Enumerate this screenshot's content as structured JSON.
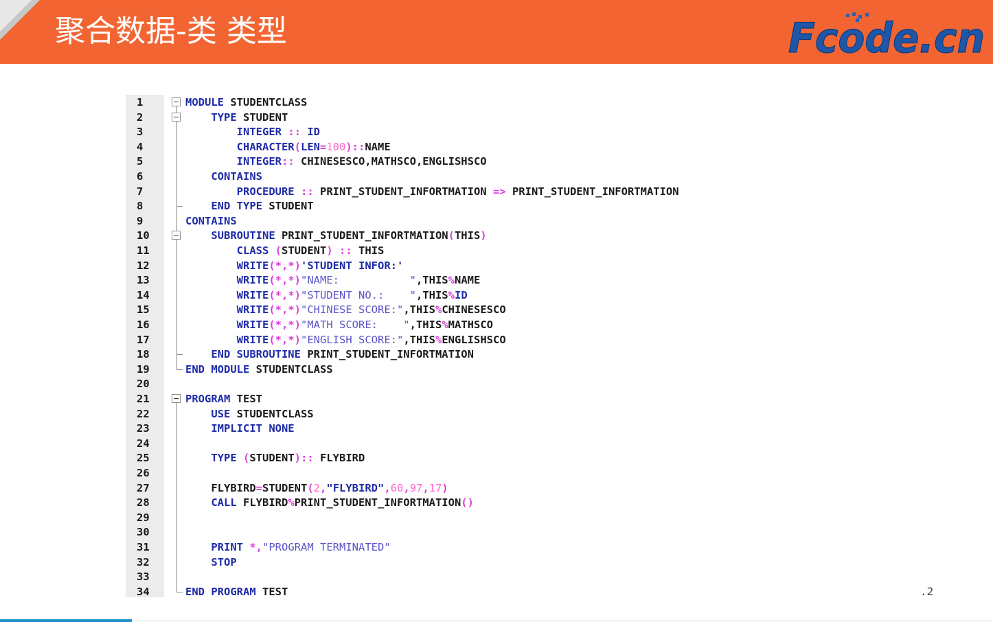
{
  "slide": {
    "title": "聚合数据-类 类型",
    "logo_text": "Fcode.cn",
    "page_mark": ".2"
  },
  "colors": {
    "header": "#f26532",
    "keyword": "#1f2ca8",
    "operator": "#d940d9",
    "number": "#ff66cc",
    "string": "#5b54c8",
    "gutter": "#ececec"
  },
  "code": {
    "lines": [
      {
        "n": "1",
        "tokens": [
          [
            "kw",
            "MODULE"
          ],
          [
            "id",
            " STUDENTCLASS"
          ]
        ]
      },
      {
        "n": "2",
        "tokens": [
          [
            "id",
            "    "
          ],
          [
            "kw",
            "TYPE"
          ],
          [
            "id",
            " STUDENT"
          ]
        ]
      },
      {
        "n": "3",
        "tokens": [
          [
            "id",
            "        "
          ],
          [
            "kw",
            "INTEGER"
          ],
          [
            "id",
            " "
          ],
          [
            "op",
            "::"
          ],
          [
            "id",
            " "
          ],
          [
            "kw",
            "ID"
          ]
        ]
      },
      {
        "n": "4",
        "tokens": [
          [
            "id",
            "        "
          ],
          [
            "kw",
            "CHARACTER"
          ],
          [
            "op",
            "("
          ],
          [
            "kw",
            "LEN"
          ],
          [
            "op",
            "="
          ],
          [
            "num",
            "100"
          ],
          [
            "op",
            ")::"
          ],
          [
            "id",
            "NAME"
          ]
        ]
      },
      {
        "n": "5",
        "tokens": [
          [
            "id",
            "        "
          ],
          [
            "kw",
            "INTEGER"
          ],
          [
            "op",
            "::"
          ],
          [
            "id",
            " CHINESESCO,MATHSCO,ENGLISHSCO"
          ]
        ]
      },
      {
        "n": "6",
        "tokens": [
          [
            "id",
            "    "
          ],
          [
            "kw",
            "CONTAINS"
          ]
        ]
      },
      {
        "n": "7",
        "tokens": [
          [
            "id",
            "        "
          ],
          [
            "kw",
            "PROCEDURE"
          ],
          [
            "id",
            " "
          ],
          [
            "op",
            "::"
          ],
          [
            "id",
            " PRINT_STUDENT_INFORTMATION "
          ],
          [
            "op",
            "=>"
          ],
          [
            "id",
            " PRINT_STUDENT_INFORTMATION"
          ]
        ]
      },
      {
        "n": "8",
        "tokens": [
          [
            "id",
            "    "
          ],
          [
            "kw",
            "END TYPE"
          ],
          [
            "id",
            " STUDENT"
          ]
        ]
      },
      {
        "n": "9",
        "tokens": [
          [
            "kw",
            "CONTAINS"
          ]
        ]
      },
      {
        "n": "10",
        "tokens": [
          [
            "id",
            "    "
          ],
          [
            "kw",
            "SUBROUTINE"
          ],
          [
            "id",
            " PRINT_STUDENT_INFORTMATION"
          ],
          [
            "op",
            "("
          ],
          [
            "id",
            "THIS"
          ],
          [
            "op",
            ")"
          ]
        ]
      },
      {
        "n": "11",
        "tokens": [
          [
            "id",
            "        "
          ],
          [
            "kw",
            "CLASS"
          ],
          [
            "id",
            " "
          ],
          [
            "op",
            "("
          ],
          [
            "id",
            "STUDENT"
          ],
          [
            "op",
            ")"
          ],
          [
            "id",
            " "
          ],
          [
            "op",
            "::"
          ],
          [
            "id",
            " THIS"
          ]
        ]
      },
      {
        "n": "12",
        "tokens": [
          [
            "id",
            "        "
          ],
          [
            "kw",
            "WRITE"
          ],
          [
            "op",
            "(*,*)"
          ],
          [
            "strk",
            "'STUDENT INFOR:'"
          ]
        ]
      },
      {
        "n": "13",
        "tokens": [
          [
            "id",
            "        "
          ],
          [
            "kw",
            "WRITE"
          ],
          [
            "op",
            "(*,*)"
          ],
          [
            "str",
            "\"NAME:           \""
          ],
          [
            "id",
            ",THIS"
          ],
          [
            "op",
            "%"
          ],
          [
            "id",
            "NAME"
          ]
        ]
      },
      {
        "n": "14",
        "tokens": [
          [
            "id",
            "        "
          ],
          [
            "kw",
            "WRITE"
          ],
          [
            "op",
            "(*,*)"
          ],
          [
            "str",
            "\"STUDENT NO.:    \""
          ],
          [
            "id",
            ",THIS"
          ],
          [
            "op",
            "%"
          ],
          [
            "kw",
            "ID"
          ]
        ]
      },
      {
        "n": "15",
        "tokens": [
          [
            "id",
            "        "
          ],
          [
            "kw",
            "WRITE"
          ],
          [
            "op",
            "(*,*)"
          ],
          [
            "str",
            "\"CHINESE SCORE:\""
          ],
          [
            "id",
            ",THIS"
          ],
          [
            "op",
            "%"
          ],
          [
            "id",
            "CHINESESCO"
          ]
        ]
      },
      {
        "n": "16",
        "tokens": [
          [
            "id",
            "        "
          ],
          [
            "kw",
            "WRITE"
          ],
          [
            "op",
            "(*,*)"
          ],
          [
            "str",
            "\"MATH SCORE:    \""
          ],
          [
            "id",
            ",THIS"
          ],
          [
            "op",
            "%"
          ],
          [
            "id",
            "MATHSCO"
          ]
        ]
      },
      {
        "n": "17",
        "tokens": [
          [
            "id",
            "        "
          ],
          [
            "kw",
            "WRITE"
          ],
          [
            "op",
            "(*,*)"
          ],
          [
            "str",
            "\"ENGLISH SCORE:\""
          ],
          [
            "id",
            ",THIS"
          ],
          [
            "op",
            "%"
          ],
          [
            "id",
            "ENGLISHSCO"
          ]
        ]
      },
      {
        "n": "18",
        "tokens": [
          [
            "id",
            "    "
          ],
          [
            "kw",
            "END SUBROUTINE"
          ],
          [
            "id",
            " PRINT_STUDENT_INFORTMATION"
          ]
        ]
      },
      {
        "n": "19",
        "tokens": [
          [
            "kw",
            "END MODULE"
          ],
          [
            "id",
            " STUDENTCLASS"
          ]
        ]
      },
      {
        "n": "20",
        "tokens": []
      },
      {
        "n": "21",
        "tokens": [
          [
            "kw",
            "PROGRAM"
          ],
          [
            "id",
            " TEST"
          ]
        ]
      },
      {
        "n": "22",
        "tokens": [
          [
            "id",
            "    "
          ],
          [
            "kw",
            "USE"
          ],
          [
            "id",
            " STUDENTCLASS"
          ]
        ]
      },
      {
        "n": "23",
        "tokens": [
          [
            "id",
            "    "
          ],
          [
            "kw",
            "IMPLICIT NONE"
          ]
        ]
      },
      {
        "n": "24",
        "tokens": []
      },
      {
        "n": "25",
        "tokens": [
          [
            "id",
            "    "
          ],
          [
            "kw",
            "TYPE"
          ],
          [
            "id",
            " "
          ],
          [
            "op",
            "("
          ],
          [
            "id",
            "STUDENT"
          ],
          [
            "op",
            ")::"
          ],
          [
            "id",
            " FLYBIRD"
          ]
        ]
      },
      {
        "n": "26",
        "tokens": []
      },
      {
        "n": "27",
        "tokens": [
          [
            "id",
            "    FLYBIRD"
          ],
          [
            "op",
            "="
          ],
          [
            "id",
            "STUDENT"
          ],
          [
            "op",
            "("
          ],
          [
            "num",
            "2"
          ],
          [
            "op",
            ","
          ],
          [
            "strk",
            "\"FLYBIRD\""
          ],
          [
            "op",
            ","
          ],
          [
            "num",
            "60"
          ],
          [
            "op",
            ","
          ],
          [
            "num",
            "97"
          ],
          [
            "op",
            ","
          ],
          [
            "num",
            "17"
          ],
          [
            "op",
            ")"
          ]
        ]
      },
      {
        "n": "28",
        "tokens": [
          [
            "id",
            "    "
          ],
          [
            "kw",
            "CALL"
          ],
          [
            "id",
            " FLYBIRD"
          ],
          [
            "op",
            "%"
          ],
          [
            "id",
            "PRINT_STUDENT_INFORTMATION"
          ],
          [
            "op",
            "()"
          ]
        ]
      },
      {
        "n": "29",
        "tokens": []
      },
      {
        "n": "30",
        "tokens": []
      },
      {
        "n": "31",
        "tokens": [
          [
            "id",
            "    "
          ],
          [
            "kw",
            "PRINT"
          ],
          [
            "id",
            " "
          ],
          [
            "op",
            "*,"
          ],
          [
            "str",
            "\"PROGRAM TERMINATED\""
          ]
        ]
      },
      {
        "n": "32",
        "tokens": [
          [
            "id",
            "    "
          ],
          [
            "kw",
            "STOP"
          ]
        ]
      },
      {
        "n": "33",
        "tokens": []
      },
      {
        "n": "34",
        "tokens": [
          [
            "kw",
            "END PROGRAM"
          ],
          [
            "id",
            " TEST"
          ]
        ]
      }
    ]
  }
}
